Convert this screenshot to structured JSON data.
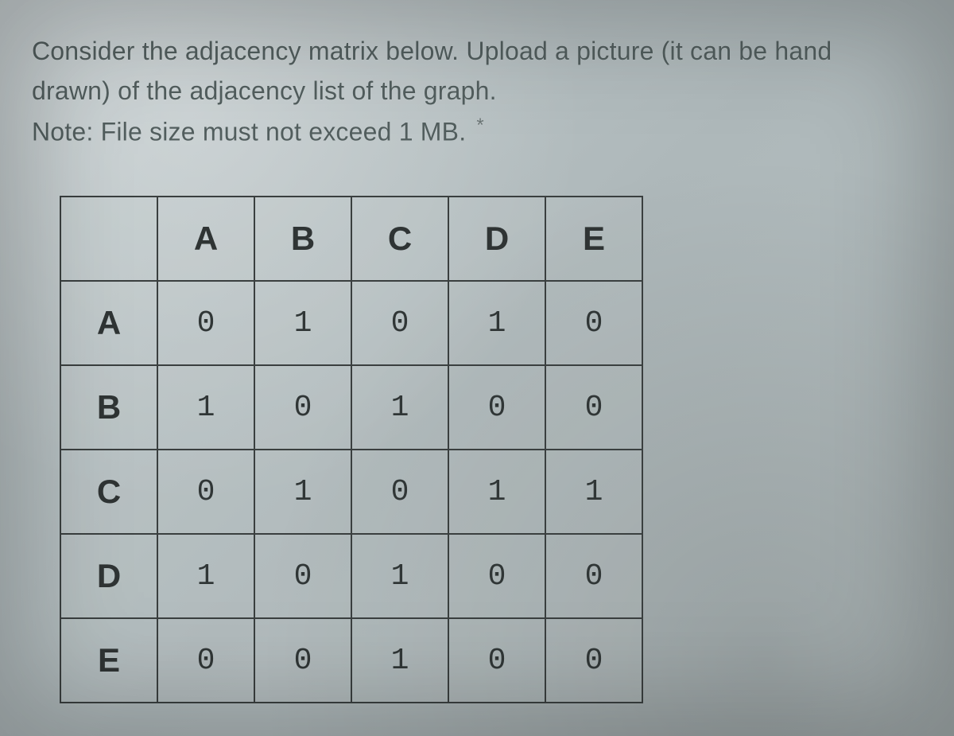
{
  "prompt": {
    "line1": "Consider the adjacency matrix below. Upload a picture (it can be hand",
    "line2": "drawn) of the adjacency list of the graph.",
    "line3": "Note: File size must not exceed 1 MB.",
    "required_marker": "*"
  },
  "chart_data": {
    "type": "table",
    "title": "Adjacency matrix",
    "col_headers": [
      "A",
      "B",
      "C",
      "D",
      "E"
    ],
    "row_headers": [
      "A",
      "B",
      "C",
      "D",
      "E"
    ],
    "rows": [
      [
        "0",
        "1",
        "0",
        "1",
        "0"
      ],
      [
        "1",
        "0",
        "1",
        "0",
        "0"
      ],
      [
        "0",
        "1",
        "0",
        "1",
        "1"
      ],
      [
        "1",
        "0",
        "1",
        "0",
        "0"
      ],
      [
        "0",
        "0",
        "1",
        "0",
        "0"
      ]
    ]
  }
}
